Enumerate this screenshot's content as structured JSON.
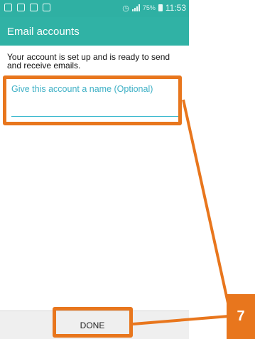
{
  "status_bar": {
    "time": "11:53",
    "battery_percent": "75%",
    "left_icons": [
      "email-notification-icon",
      "photo-icon",
      "gallery-icon",
      "sim-icon"
    ],
    "right_icons": [
      "alarm-icon",
      "signal-icon",
      "battery-icon"
    ]
  },
  "app_bar": {
    "title": "Email accounts"
  },
  "content": {
    "message": "Your account is set up and is ready to send and receive emails.",
    "name_field_label": "Give this account a name (Optional)"
  },
  "bottom_bar": {
    "done_label": "DONE"
  },
  "tutorial": {
    "step_number": "7",
    "accent_color": "#e8761d"
  },
  "colors": {
    "app_bar": "#30b2a5",
    "field_accent": "#40b1c6"
  }
}
